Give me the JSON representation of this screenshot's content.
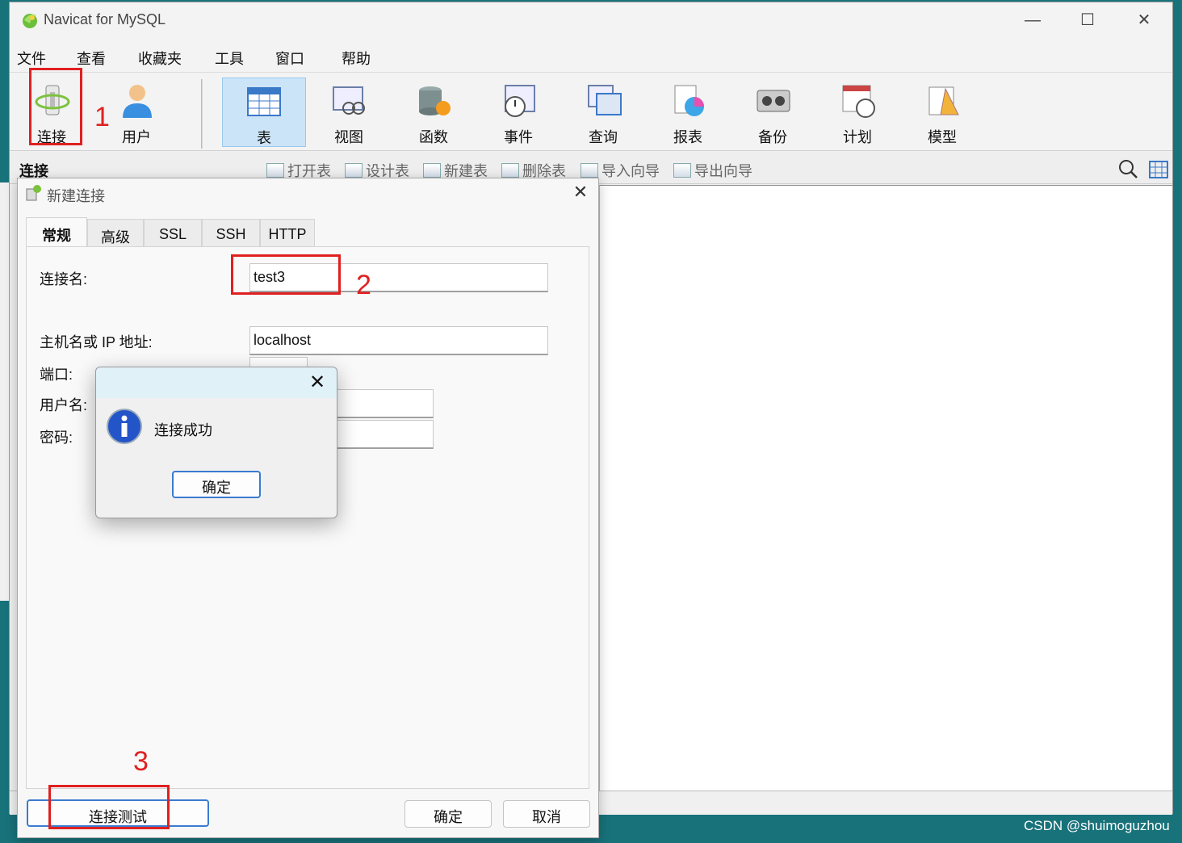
{
  "window": {
    "title": "Navicat for MySQL"
  },
  "menu": [
    "文件",
    "查看",
    "收藏夹",
    "工具",
    "窗口",
    "帮助"
  ],
  "toolbar": {
    "items": [
      "连接",
      "用户",
      "表",
      "视图",
      "函数",
      "事件",
      "查询",
      "报表",
      "备份",
      "计划",
      "模型"
    ],
    "active": "表"
  },
  "subtoolbar": {
    "pane_label": "连接",
    "buttons": [
      "打开表",
      "设计表",
      "新建表",
      "删除表",
      "导入向导",
      "导出向导"
    ]
  },
  "dialog": {
    "title": "新建连接",
    "tabs": [
      "常规",
      "高级",
      "SSL",
      "SSH",
      "HTTP"
    ],
    "active_tab": "常规",
    "fields": {
      "connection_name_label": "连接名:",
      "connection_name_value": "test3",
      "host_label": "主机名或 IP 地址:",
      "host_value": "localhost",
      "port_label": "端口:",
      "user_label": "用户名:",
      "password_label": "密码:"
    },
    "buttons": {
      "test": "连接测试",
      "ok": "确定",
      "cancel": "取消"
    }
  },
  "message_box": {
    "text": "连接成功",
    "ok": "确定"
  },
  "annotations": [
    "1",
    "2",
    "3"
  ],
  "watermark": "CSDN @shuimoguzhou",
  "colors": {
    "annotation_red": "#e02020",
    "active_tool_bg": "#cce4f7",
    "desktop": "#18727a"
  }
}
